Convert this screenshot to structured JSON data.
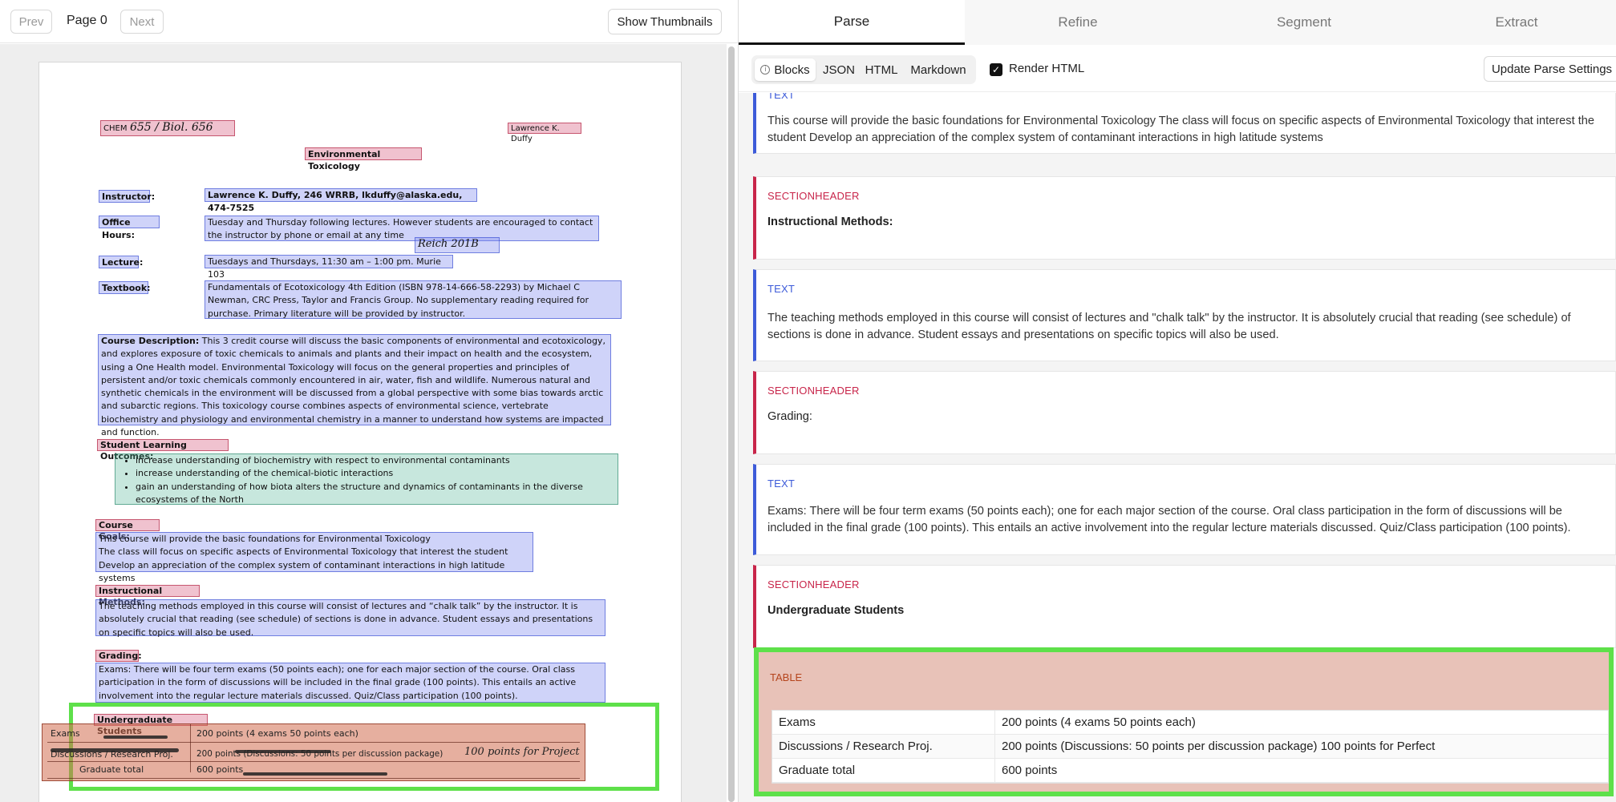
{
  "left_toolbar": {
    "prev": "Prev",
    "page": "Page 0",
    "next": "Next",
    "thumbnails": "Show Thumbnails"
  },
  "document": {
    "course_code": "CHEM",
    "course_code_hand": "655 / Biol. 656",
    "author": "Lawrence K. Duffy",
    "title": "Environmental Toxicology",
    "instructor_label": "Instructor:",
    "instructor_value": "Lawrence K. Duffy, 246 WRRB, lkduffy@alaska.edu, 474-7525",
    "office_label": "Office Hours:",
    "office_value": "Tuesday and Thursday following lectures. However students are encouraged to contact the instructor by phone or email at any time",
    "hand_note": "Reich 201B",
    "lecture_label": "Lecture:",
    "lecture_value": "Tuesdays and Thursdays, 11:30 am – 1:00 pm. Murie 103",
    "textbook_label": "Textbook:",
    "textbook_value": "Fundamentals of Ecotoxicology 4th Edition (ISBN 978-14-666-58-2293) by Michael C Newman, CRC Press, Taylor and Francis Group.  No supplementary reading required for purchase.  Primary literature will be provided by instructor.",
    "description_label": "Course Description:",
    "description_value": "This 3 credit course will discuss the basic components of environmental and ecotoxicology, and explores exposure of toxic chemicals to animals and plants and their impact on health and the ecosystem, using a One Health model.  Environmental Toxicology will focus on the general properties and principles of persistent and/or toxic chemicals commonly encountered in air, water, fish and wildlife.  Numerous natural and synthetic chemicals in the environment will be discussed from a global perspective with some bias towards arctic and subarctic regions.  This toxicology course combines aspects of environmental science, vertebrate biochemistry and physiology and environmental chemistry in a manner to understand how systems are impacted and function.",
    "outcomes_label": "Student Learning Outcomes:",
    "outcomes": [
      "increase understanding of biochemistry  with respect to environmental contaminants",
      "increase understanding of the chemical-biotic interactions",
      "gain an understanding of how biota alters the structure and dynamics of contaminants in the diverse ecosystems of the North"
    ],
    "goals_label": "Course Goals:",
    "goals": [
      "This course will provide the basic foundations for Environmental Toxicology",
      "The class will focus on specific aspects of Environmental Toxicology that interest the student",
      "Develop an appreciation of the complex system of contaminant interactions in high latitude systems"
    ],
    "methods_label": "Instructional Methods:",
    "methods_value": "The teaching methods employed in this course will consist of lectures and “chalk talk” by the instructor.  It is absolutely crucial that reading (see schedule) of sections is done in advance.  Student essays and presentations on specific topics will also be used.",
    "grading_label": "Grading:",
    "grading_value": "Exams:  There will be four term exams (50 points each); one for each major section of the course. Oral class participation in the form of discussions will be included in the final grade (100 points).  This entails an active involvement into the regular lecture materials discussed.  Quiz/Class participation (100 points).",
    "undergrad_label": "Undergraduate Students",
    "table_rows": [
      {
        "c1": "Exams",
        "c2": "200 points (4 exams 50 points each)"
      },
      {
        "c1": "Discussions / Research Proj.",
        "c2": "200 points (Discussions: 50 points per discussion package)"
      },
      {
        "c1": "Graduate total",
        "c2": "600 points"
      }
    ],
    "table_hand_note": "100 points for Project"
  },
  "tabs": [
    "Parse",
    "Refine",
    "Segment",
    "Extract"
  ],
  "parsebar": {
    "views": [
      "Blocks",
      "JSON",
      "HTML",
      "Markdown"
    ],
    "render_label": "Render HTML",
    "update_label": "Update Parse Settings"
  },
  "blocks": [
    {
      "kind": "TEXT",
      "content": "This course will provide the basic foundations for Environmental Toxicology The class will focus on specific aspects of Environmental Toxicology that interest the student Develop an appreciation of the complex system of contaminant interactions in high latitude systems"
    },
    {
      "kind": "SECTIONHEADER",
      "content": "Instructional Methods:"
    },
    {
      "kind": "TEXT",
      "content": "The teaching methods employed in this course will consist of lectures and \"chalk talk\" by the instructor. It is absolutely crucial that reading (see schedule) of sections is done in advance. Student essays and presentations on specific topics will also be used."
    },
    {
      "kind": "SECTIONHEADER",
      "content": "Grading:"
    },
    {
      "kind": "TEXT",
      "content": "Exams: There will be four term exams (50 points each); one for each major section of the course. Oral class participation in the form of discussions will be included in the final grade (100 points). This entails an active involvement into the regular lecture materials discussed. Quiz/Class participation (100 points)."
    },
    {
      "kind": "SECTIONHEADER",
      "content": "Undergraduate Students"
    }
  ],
  "table_block": {
    "kind": "TABLE",
    "rows": [
      {
        "c1": "Exams",
        "c2": "200 points (4 exams 50 points each)"
      },
      {
        "c1": "Discussions / Research Proj.",
        "c2": "200 points (Discussions: 50 points per discussion package) 100 points for Perfect"
      },
      {
        "c1": "Graduate total",
        "c2": "600 points"
      }
    ]
  },
  "colors": {
    "text_accent": "#3d5bd9",
    "section_accent": "#c8254a",
    "table_accent": "#b5441c",
    "selection": "#5ee04a"
  }
}
